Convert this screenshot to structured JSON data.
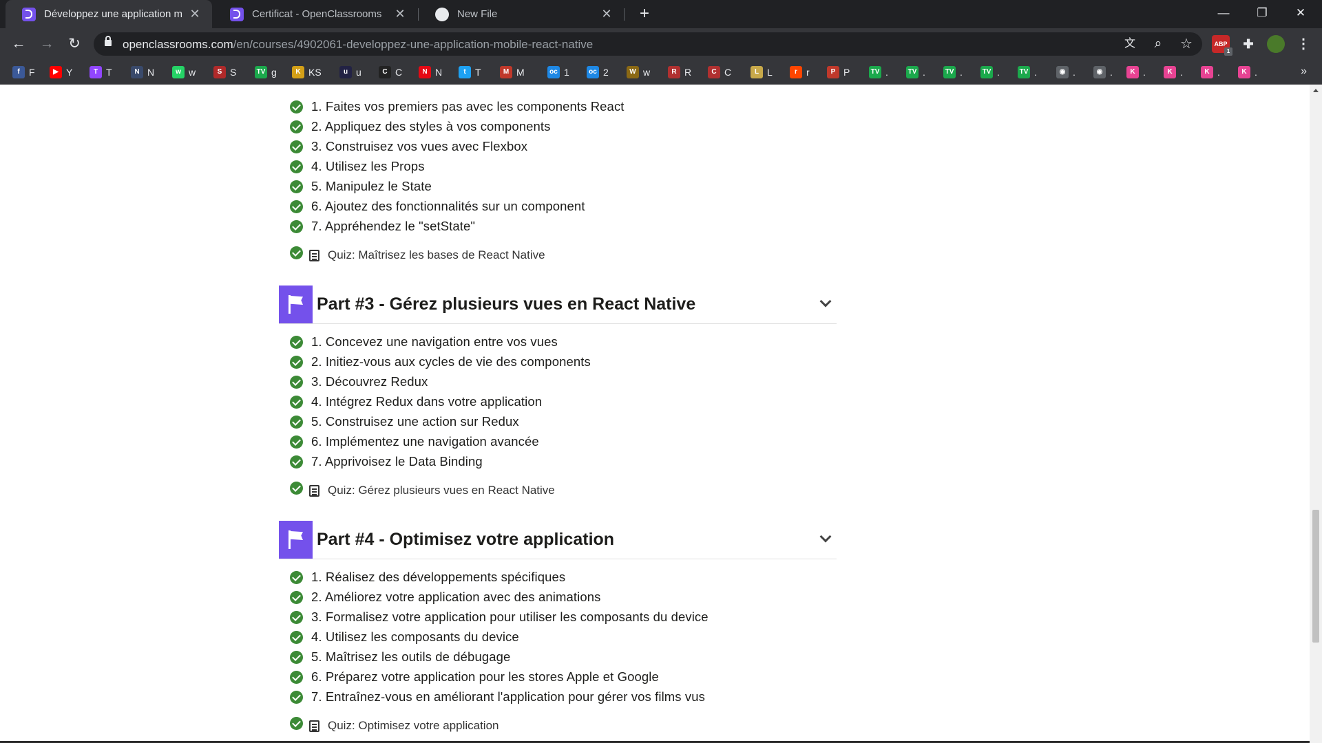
{
  "browser": {
    "tabs": [
      {
        "title": "Développez une application mob",
        "icon": "openclassrooms-icon",
        "active": true
      },
      {
        "title": "Certificat - OpenClassrooms",
        "icon": "openclassrooms-icon",
        "active": false
      },
      {
        "title": "New File",
        "icon": "github-icon",
        "active": false
      }
    ],
    "new_tab_label": "+",
    "window_controls": {
      "minimize": "—",
      "restore": "❐",
      "close": "✕"
    },
    "nav": {
      "back": "←",
      "forward": "→",
      "reload": "↻"
    },
    "url": {
      "host": "openclassrooms.com",
      "path": "/en/courses/4902061-developpez-une-application-mobile-react-native"
    },
    "omnibox_icons": {
      "translate": "文",
      "zoom": "⌕",
      "bookmark": "☆"
    },
    "extensions": {
      "adblock": "ABP",
      "adblock_badge": "1",
      "puzzle": "✚",
      "menu": "⋮"
    },
    "bookmarks": [
      {
        "label": "F",
        "icon": "facebook-icon",
        "color": "#3b5998",
        "glyph": "f"
      },
      {
        "label": "Y",
        "icon": "youtube-icon",
        "color": "#ff0000",
        "glyph": "▶"
      },
      {
        "label": "T",
        "icon": "twitch-icon",
        "color": "#9146ff",
        "glyph": "T"
      },
      {
        "label": "N",
        "icon": "game-icon",
        "color": "#3a4a6b",
        "glyph": "N"
      },
      {
        "label": "w",
        "icon": "whatsapp-icon",
        "color": "#25d366",
        "glyph": "w"
      },
      {
        "label": "S",
        "icon": "sport-icon",
        "color": "#b02a2a",
        "glyph": "S"
      },
      {
        "label": "g",
        "icon": "tv-icon",
        "color": "#1ba94c",
        "glyph": "TV"
      },
      {
        "label": "KS",
        "icon": "ks-icon",
        "color": "#d4a017",
        "glyph": "K"
      },
      {
        "label": "u",
        "icon": "u-icon",
        "color": "#222244",
        "glyph": "u"
      },
      {
        "label": "C",
        "icon": "chart-icon",
        "color": "#222222",
        "glyph": "C"
      },
      {
        "label": "N",
        "icon": "netflix-icon",
        "color": "#e50914",
        "glyph": "N"
      },
      {
        "label": "T",
        "icon": "twitter-icon",
        "color": "#1da1f2",
        "glyph": "t"
      },
      {
        "label": "M",
        "icon": "m-icon",
        "color": "#c0392b",
        "glyph": "M"
      },
      {
        "label": "1",
        "icon": "openclassrooms-blue-icon",
        "color": "#1e88e5",
        "glyph": "oc"
      },
      {
        "label": "2",
        "icon": "openclassrooms-blue-icon",
        "color": "#1e88e5",
        "glyph": "oc"
      },
      {
        "label": "w",
        "icon": "wow-icon",
        "color": "#8b6914",
        "glyph": "W"
      },
      {
        "label": "R",
        "icon": "r-icon",
        "color": "#b03030",
        "glyph": "R"
      },
      {
        "label": "C",
        "icon": "c-icon",
        "color": "#b03030",
        "glyph": "C"
      },
      {
        "label": "L",
        "icon": "league-icon",
        "color": "#c8a94a",
        "glyph": "L"
      },
      {
        "label": "r",
        "icon": "reddit-icon",
        "color": "#ff4500",
        "glyph": "r"
      },
      {
        "label": "P",
        "icon": "p-icon",
        "color": "#c0392b",
        "glyph": "P"
      },
      {
        "label": ".",
        "icon": "tv-icon",
        "color": "#1ba94c",
        "glyph": "TV"
      },
      {
        "label": ".",
        "icon": "tv-icon",
        "color": "#1ba94c",
        "glyph": "TV"
      },
      {
        "label": ".",
        "icon": "tv-icon",
        "color": "#1ba94c",
        "glyph": "TV"
      },
      {
        "label": ".",
        "icon": "tv-icon",
        "color": "#1ba94c",
        "glyph": "TV"
      },
      {
        "label": ".",
        "icon": "tv-icon",
        "color": "#1ba94c",
        "glyph": "TV"
      },
      {
        "label": ".",
        "icon": "globe-icon",
        "color": "#5f6368",
        "glyph": "◉"
      },
      {
        "label": ".",
        "icon": "globe-icon",
        "color": "#5f6368",
        "glyph": "◉"
      },
      {
        "label": ".",
        "icon": "k-icon",
        "color": "#e84393",
        "glyph": "K"
      },
      {
        "label": ".",
        "icon": "k-icon",
        "color": "#e84393",
        "glyph": "K"
      },
      {
        "label": ".",
        "icon": "k-icon",
        "color": "#e84393",
        "glyph": "K"
      },
      {
        "label": ".",
        "icon": "k-icon",
        "color": "#e84393",
        "glyph": "K"
      }
    ],
    "bookmarks_more": "»"
  },
  "course": {
    "accent_color": "#7451eb",
    "check_color": "#3c8a36",
    "part2": {
      "chapters": [
        "1. Faites vos premiers pas avec les components React",
        "2. Appliquez des styles à vos components",
        "3. Construisez vos vues avec Flexbox",
        "4. Utilisez les Props",
        "5. Manipulez le State",
        "6. Ajoutez des fonctionnalités sur un component",
        "7. Appréhendez le \"setState\""
      ],
      "quiz": "Quiz: Maîtrisez les bases de React Native"
    },
    "part3": {
      "title": "Part #3 - Gérez plusieurs vues en React Native",
      "chapters": [
        "1. Concevez une navigation entre vos vues",
        "2. Initiez-vous aux cycles de vie des components",
        "3. Découvrez Redux",
        "4. Intégrez Redux dans votre application",
        "5. Construisez une action sur Redux",
        "6. Implémentez une navigation avancée",
        "7. Apprivoisez le Data Binding"
      ],
      "quiz": "Quiz: Gérez plusieurs vues en React Native"
    },
    "part4": {
      "title": "Part #4 - Optimisez votre application",
      "chapters": [
        "1. Réalisez des développements spécifiques",
        "2. Améliorez votre application avec des animations",
        "3. Formalisez votre application pour utiliser les composants du device",
        "4. Utilisez les composants du device",
        "5. Maîtrisez les outils de débugage",
        "6. Préparez votre application pour les stores Apple et Google",
        "7. Entraînez-vous en améliorant l'application pour gérer vos films vus"
      ],
      "quiz": "Quiz: Optimisez votre application"
    }
  }
}
